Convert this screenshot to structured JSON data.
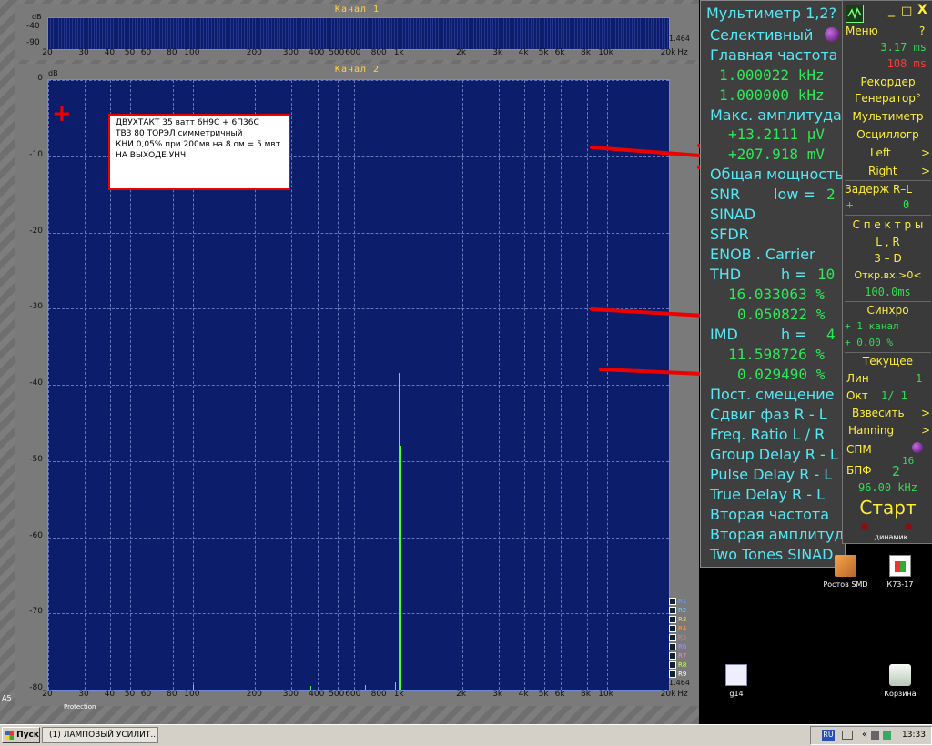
{
  "channel1": {
    "title": "Канал 1",
    "db_label": "dB",
    "y_ticks": [
      "-40",
      "-90"
    ],
    "corner_value": "1.464",
    "x_ticks": [
      "20",
      "30",
      "40",
      "50",
      "60",
      "80",
      "100",
      "200",
      "300",
      "400",
      "500",
      "600",
      "800",
      "1k",
      "2k",
      "3k",
      "4k",
      "5k",
      "6k",
      "8k",
      "10k",
      "20k"
    ],
    "x_unit": "Hz"
  },
  "channel2": {
    "title": "Канал 2",
    "db_label": "dB",
    "y_ticks": [
      "0",
      "-10",
      "-20",
      "-30",
      "-40",
      "-50",
      "-60",
      "-70",
      "-80"
    ],
    "corner_value": "1.464",
    "x_ticks": [
      "20",
      "30",
      "40",
      "50",
      "60",
      "80",
      "100",
      "200",
      "300",
      "400",
      "500",
      "600",
      "800",
      "1k",
      "2k",
      "3k",
      "4k",
      "5k",
      "6k",
      "8k",
      "10k",
      "20k"
    ],
    "x_unit": "Hz",
    "legend": [
      "R1",
      "R2",
      "R3",
      "R4",
      "R5",
      "R6",
      "R7",
      "R8",
      "R9"
    ],
    "cursor_glyph": "+"
  },
  "note": [
    "ДВУХТАКТ  35  ватт  6Н9С + 6П36С",
    "ТВЗ 80 ТОРЭЛ симметричный",
    "КНИ 0,05% при 200мв  на 8 ом = 5 мвт",
    "НА ВЫХОДЕ  УНЧ"
  ],
  "multimeter": {
    "title": "Мультиметр 1,2?",
    "mode": "Селективный",
    "main_freq_label": "Главная частота",
    "main_freq_1": "1.000022 kHz",
    "main_freq_2": "1.000000 kHz",
    "max_amp_label": "Макс. амплитуда",
    "max_amp_1": "+13.2111 µV",
    "max_amp_2": "+207.918 mV",
    "total_power": "Общая мощность",
    "snr": "SNR",
    "snr_low": "low =",
    "snr_low_val": "2",
    "sinad": "SINAD",
    "sfdr": "SFDR",
    "enob": "ENOB . Carrier",
    "thd": "THD",
    "thd_h": "h =",
    "thd_h_val": "10",
    "thd_1": "16.033063 %",
    "thd_2": "0.050822 %",
    "imd": "IMD",
    "imd_h": "h =",
    "imd_h_val": "4",
    "imd_1": "11.598726 %",
    "imd_2": "0.029490 %",
    "dc_offset": "Пост. смещение",
    "phase_shift": "Сдвиг фаз R - L",
    "freq_ratio": "Freq. Ratio  L / R",
    "group_delay": "Group Delay R - L",
    "pulse_delay": "Pulse Delay R - L",
    "true_delay": "True Delay R - L",
    "second_freq": "Вторая частота",
    "second_amp": "Вторая амплитуда",
    "two_tones": "Two Tones SINAD"
  },
  "side": {
    "close": "X",
    "minimize": "_",
    "restore": "□",
    "menu": "Меню",
    "help": "?",
    "time_1": "3.17 ms",
    "time_2": "108 ms",
    "recorder": "Рекордер",
    "generator": "Генератор°",
    "multimeter": "Мультиметр",
    "oscilloscope": "Осциллогр",
    "left": "Left",
    "right": "Right",
    "arrow": ">",
    "delay": "Задерж  R–L",
    "delay_sign": "+",
    "delay_val": "0",
    "spectra": "С п е к т р ы",
    "lr": "L , R",
    "threed": "3 – D",
    "open_in": "Откр.вх.>0<",
    "open_ms": "100.0ms",
    "sync": "Синхро",
    "sync_ch": "+ 1 канал",
    "sync_pct": "+ 0.00 %",
    "current": "Текущее",
    "lin": "Лин",
    "lin_val": "1",
    "oct": "Окт",
    "oct_val": "1/ 1",
    "weigh": "Взвесить",
    "hanning": "Hanning",
    "spm": "СПМ",
    "bpf": "БПФ",
    "bpf_base": "2",
    "bpf_exp": "16",
    "rate": "96.00 kHz",
    "start": "Старт"
  },
  "desktop": {
    "icon_top_label": "динамик",
    "icons": [
      {
        "label": "Ростов SMD"
      },
      {
        "label": "К73-17"
      },
      {
        "label": "g14"
      },
      {
        "label": "Корзина"
      }
    ],
    "left_edge_text": "A5",
    "left_bottom_text": "Protection"
  },
  "taskbar": {
    "start": "Пуск",
    "task": "(1) ЛАМПОВЫЙ УСИЛИТ...",
    "lang": "RU",
    "clock": "13:33"
  },
  "colors": {
    "plot_bg": "#0b1d6b",
    "trace": "#44ff33",
    "meter_label": "#56e8f4",
    "meter_value": "#2ee85a",
    "side_label": "#ffef3a",
    "annotation": "#e00000"
  }
}
